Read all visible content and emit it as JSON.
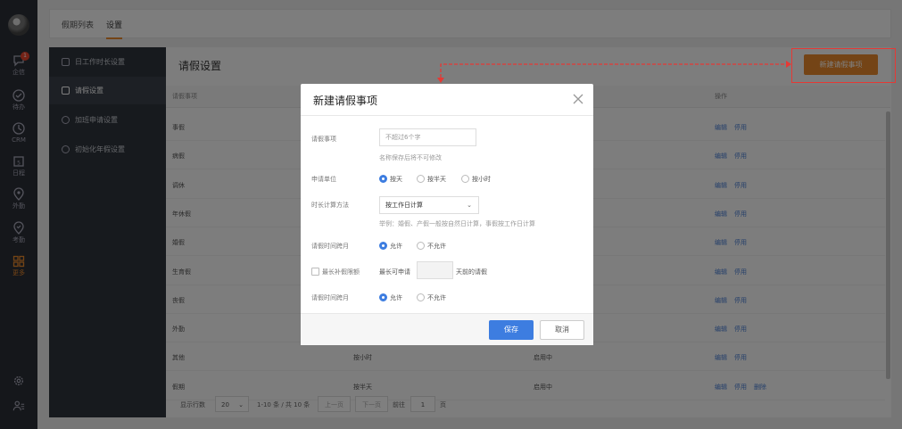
{
  "rail": {
    "badge": "1",
    "items": [
      {
        "label": "企信",
        "icon": "chat-icon"
      },
      {
        "label": "待办",
        "icon": "check-circle-icon"
      },
      {
        "label": "CRM",
        "icon": "clock-icon"
      },
      {
        "label": "日程",
        "icon": "calendar-icon"
      },
      {
        "label": "外勤",
        "icon": "location-pin-icon"
      },
      {
        "label": "考勤",
        "icon": "check-pin-icon"
      },
      {
        "label": "更多",
        "icon": "grid-icon",
        "active": true
      }
    ]
  },
  "tabs": [
    {
      "label": "假期列表"
    },
    {
      "label": "设置",
      "active": true
    }
  ],
  "settings_nav": [
    {
      "label": "日工作时长设置"
    },
    {
      "label": "请假设置",
      "active": true
    },
    {
      "label": "加班申请设置"
    },
    {
      "label": "初始化年假设置"
    }
  ],
  "content": {
    "title": "请假设置",
    "new_button": "新建请假事项",
    "headers": {
      "item": "请假事项",
      "actions": "操作"
    },
    "rows": [
      {
        "name": "事假",
        "unit": "",
        "status": "",
        "actions": [
          "编辑",
          "停用"
        ]
      },
      {
        "name": "病假",
        "unit": "",
        "status": "",
        "actions": [
          "编辑",
          "停用"
        ]
      },
      {
        "name": "调休",
        "unit": "",
        "status": "",
        "actions": [
          "编辑",
          "停用"
        ]
      },
      {
        "name": "年休假",
        "unit": "",
        "status": "",
        "actions": [
          "编辑",
          "停用"
        ]
      },
      {
        "name": "婚假",
        "unit": "",
        "status": "",
        "actions": [
          "编辑",
          "停用"
        ]
      },
      {
        "name": "生育假",
        "unit": "",
        "status": "",
        "actions": [
          "编辑",
          "停用"
        ]
      },
      {
        "name": "丧假",
        "unit": "",
        "status": "",
        "actions": [
          "编辑",
          "停用"
        ]
      },
      {
        "name": "外勤",
        "unit": "",
        "status": "",
        "actions": [
          "编辑",
          "停用"
        ]
      },
      {
        "name": "其他",
        "unit": "按小时",
        "status": "启用中",
        "actions": [
          "编辑",
          "停用"
        ]
      },
      {
        "name": "假期",
        "unit": "按半天",
        "status": "启用中",
        "actions": [
          "编辑",
          "停用",
          "删除"
        ]
      }
    ],
    "pager": {
      "rows_label": "显示行数",
      "rows_value": "20",
      "range": "1-10 条 / 共 10 条",
      "prev": "上一页",
      "next": "下一页",
      "goto_label": "前往",
      "goto_value": "1",
      "page_suffix": "页"
    }
  },
  "modal": {
    "title": "新建请假事项",
    "fields": {
      "name_label": "请假事项",
      "name_placeholder": "不超过6个字",
      "name_hint": "名称保存后将不可修改",
      "unit_label": "申请单位",
      "unit_options": [
        "按天",
        "按半天",
        "按小时"
      ],
      "calc_label": "时长计算方法",
      "calc_value": "按工作日计算",
      "calc_hint": "举例：婚假、产假一般按自然日计算，事假按工作日计算",
      "cross_label": "请假时间跨月",
      "cross_options": [
        "允许",
        "不允许"
      ],
      "limit_label": "最长补假限额",
      "limit_prefix": "最长可申请",
      "limit_suffix": "天前的请假",
      "month_label": "请假时间跨月",
      "month_options": [
        "允许",
        "不允许"
      ]
    },
    "save": "保存",
    "cancel": "取消"
  }
}
